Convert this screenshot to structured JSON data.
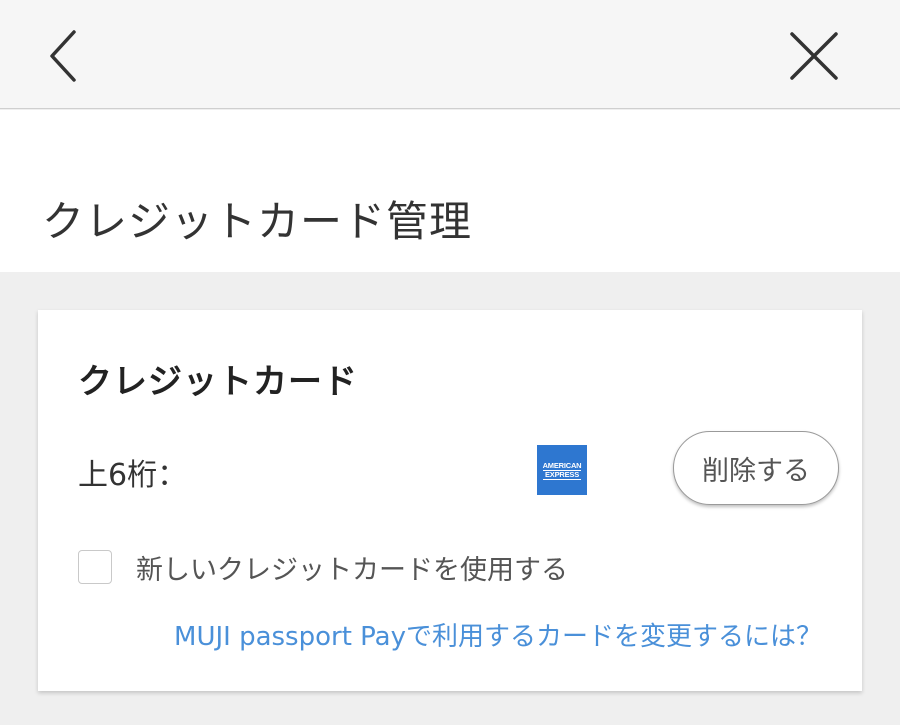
{
  "header": {
    "back_icon": "chevron-left-icon",
    "close_icon": "close-icon"
  },
  "page": {
    "title": "クレジットカード管理"
  },
  "card_section": {
    "title": "クレジットカード",
    "digits_label": "上6桁：",
    "brand_logo": {
      "line1": "AMERICAN",
      "line2": "EXPRESS",
      "color": "#2e77d0"
    },
    "delete_label": "削除する",
    "new_card_checkbox_label": "新しいクレジットカードを使用する",
    "new_card_checked": false,
    "help_link": "MUJI passport Payで利用するカードを変更するには？"
  },
  "colors": {
    "link": "#4a90d9",
    "background": "#efefef",
    "header_bg": "#f6f6f6"
  }
}
